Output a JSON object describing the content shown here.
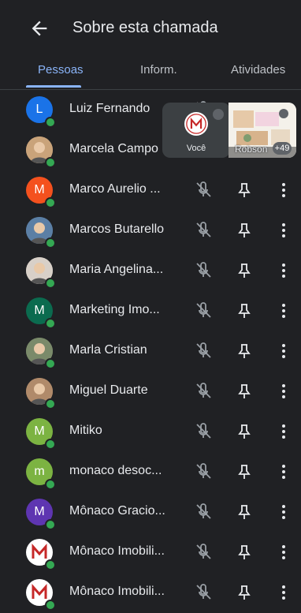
{
  "header": {
    "title": "Sobre esta chamada"
  },
  "tabs": [
    {
      "label": "Pessoas",
      "active": true
    },
    {
      "label": "Inform.",
      "active": false
    },
    {
      "label": "Atividades",
      "active": false
    }
  ],
  "overlay": {
    "self_label": "Você",
    "share_name": "Robson",
    "share_more_count": "+49"
  },
  "participants": [
    {
      "name": "Luiz Fernando",
      "initial": "L",
      "color": "#1a73e8",
      "photo": false
    },
    {
      "name": "Marcela Campo",
      "initial": "",
      "color": "#c9a37a",
      "photo": true
    },
    {
      "name": "Marco Aurelio ...",
      "initial": "M",
      "color": "#f4511e",
      "photo": false
    },
    {
      "name": "Marcos Butarello",
      "initial": "",
      "color": "#5b7fa5",
      "photo": true
    },
    {
      "name": "Maria Angelina...",
      "initial": "",
      "color": "#d8d0c8",
      "photo": true
    },
    {
      "name": "Marketing Imo...",
      "initial": "M",
      "color": "#0b6b4f",
      "photo": false
    },
    {
      "name": "Marla Cristian",
      "initial": "",
      "color": "#7a8a6a",
      "photo": true
    },
    {
      "name": "Miguel Duarte",
      "initial": "",
      "color": "#b08a6a",
      "photo": true
    },
    {
      "name": "Mitiko",
      "initial": "M",
      "color": "#7cb342",
      "photo": false
    },
    {
      "name": "monaco desoc...",
      "initial": "m",
      "color": "#7cb342",
      "photo": false
    },
    {
      "name": "Mônaco Gracio...",
      "initial": "M",
      "color": "#5e35b1",
      "photo": false
    },
    {
      "name": "Mônaco Imobili...",
      "initial": "M",
      "color": "#ffffff",
      "photo": false,
      "logo": true
    },
    {
      "name": "Mônaco Imobili...",
      "initial": "M",
      "color": "#ffffff",
      "photo": false,
      "logo": true
    }
  ]
}
